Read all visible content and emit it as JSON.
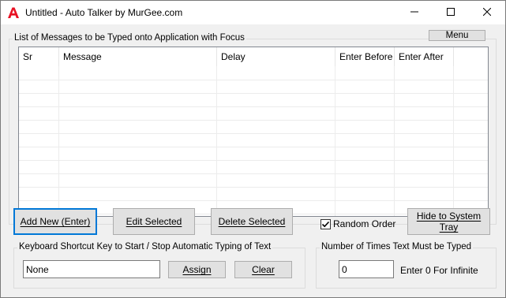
{
  "window": {
    "title": "Untitled - Auto Talker by MurGee.com",
    "app_icon": "red-a-letter-icon",
    "controls": {
      "minimize_icon": "minimize-icon",
      "maximize_icon": "maximize-icon",
      "close_icon": "close-icon"
    }
  },
  "messages_group": {
    "label": "List of Messages to be Typed onto Application with Focus",
    "menu_label": "Menu",
    "columns": [
      "Sr",
      "Message",
      "Delay",
      "Enter Before",
      "Enter After"
    ],
    "rows": []
  },
  "actions": {
    "add_new": "Add New (Enter)",
    "edit_selected": "Edit Selected",
    "delete_selected": "Delete Selected",
    "random_order_label": "Random Order",
    "random_order_checked": true,
    "hide_to_tray": "Hide to System Tray"
  },
  "shortcut_group": {
    "label": "Keyboard Shortcut Key to Start / Stop Automatic Typing of Text",
    "value": "None",
    "assign_label": "Assign",
    "clear_label": "Clear"
  },
  "times_group": {
    "label": "Number of Times Text Must be Typed",
    "value": "0",
    "hint": "Enter 0 For Infinite"
  },
  "colors": {
    "accent": "#0078d7",
    "icon_red": "#e81123",
    "panel_bg": "#f0f0f0",
    "button_bg": "#e1e1e1"
  }
}
